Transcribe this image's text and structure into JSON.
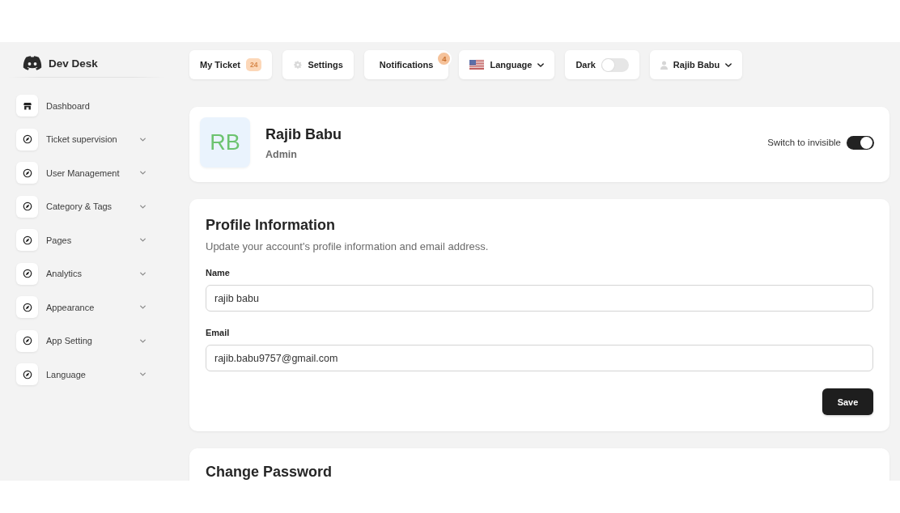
{
  "brand": {
    "name": "Dev Desk"
  },
  "sidebar": {
    "items": [
      {
        "label": "Dashboard",
        "kind": "link"
      },
      {
        "label": "Ticket supervision",
        "kind": "group"
      },
      {
        "label": "User Management",
        "kind": "group"
      },
      {
        "label": "Category & Tags",
        "kind": "group"
      },
      {
        "label": "Pages",
        "kind": "group"
      },
      {
        "label": "Analytics",
        "kind": "group"
      },
      {
        "label": "Appearance",
        "kind": "group"
      },
      {
        "label": "App Setting",
        "kind": "group"
      },
      {
        "label": "Language",
        "kind": "group"
      }
    ]
  },
  "topbar": {
    "buttons": [
      {
        "kind": "ticket",
        "label": "My Ticket",
        "badge": "24"
      },
      {
        "kind": "settings",
        "label": "Settings"
      },
      {
        "kind": "notifications",
        "label": "Notifications",
        "badge": "4"
      },
      {
        "kind": "language",
        "label": "Language"
      },
      {
        "kind": "theme",
        "label": "Dark",
        "on": false
      },
      {
        "kind": "user",
        "label": "Rajib Babu"
      }
    ]
  },
  "profile_card": {
    "initials": "RB",
    "name": "Rajib Babu",
    "role": "Admin",
    "invisible_switch": {
      "label": "Switch to invisible",
      "on": true
    }
  },
  "profile_information": {
    "title": "Profile Information",
    "description": "Update your account's profile information and email address.",
    "fields": [
      {
        "label": "Name",
        "value": "rajib babu"
      },
      {
        "label": "Email",
        "value": "rajib.babu9757@gmail.com"
      }
    ],
    "save_button": "Save"
  },
  "change_password": {
    "title": "Change Password"
  }
}
